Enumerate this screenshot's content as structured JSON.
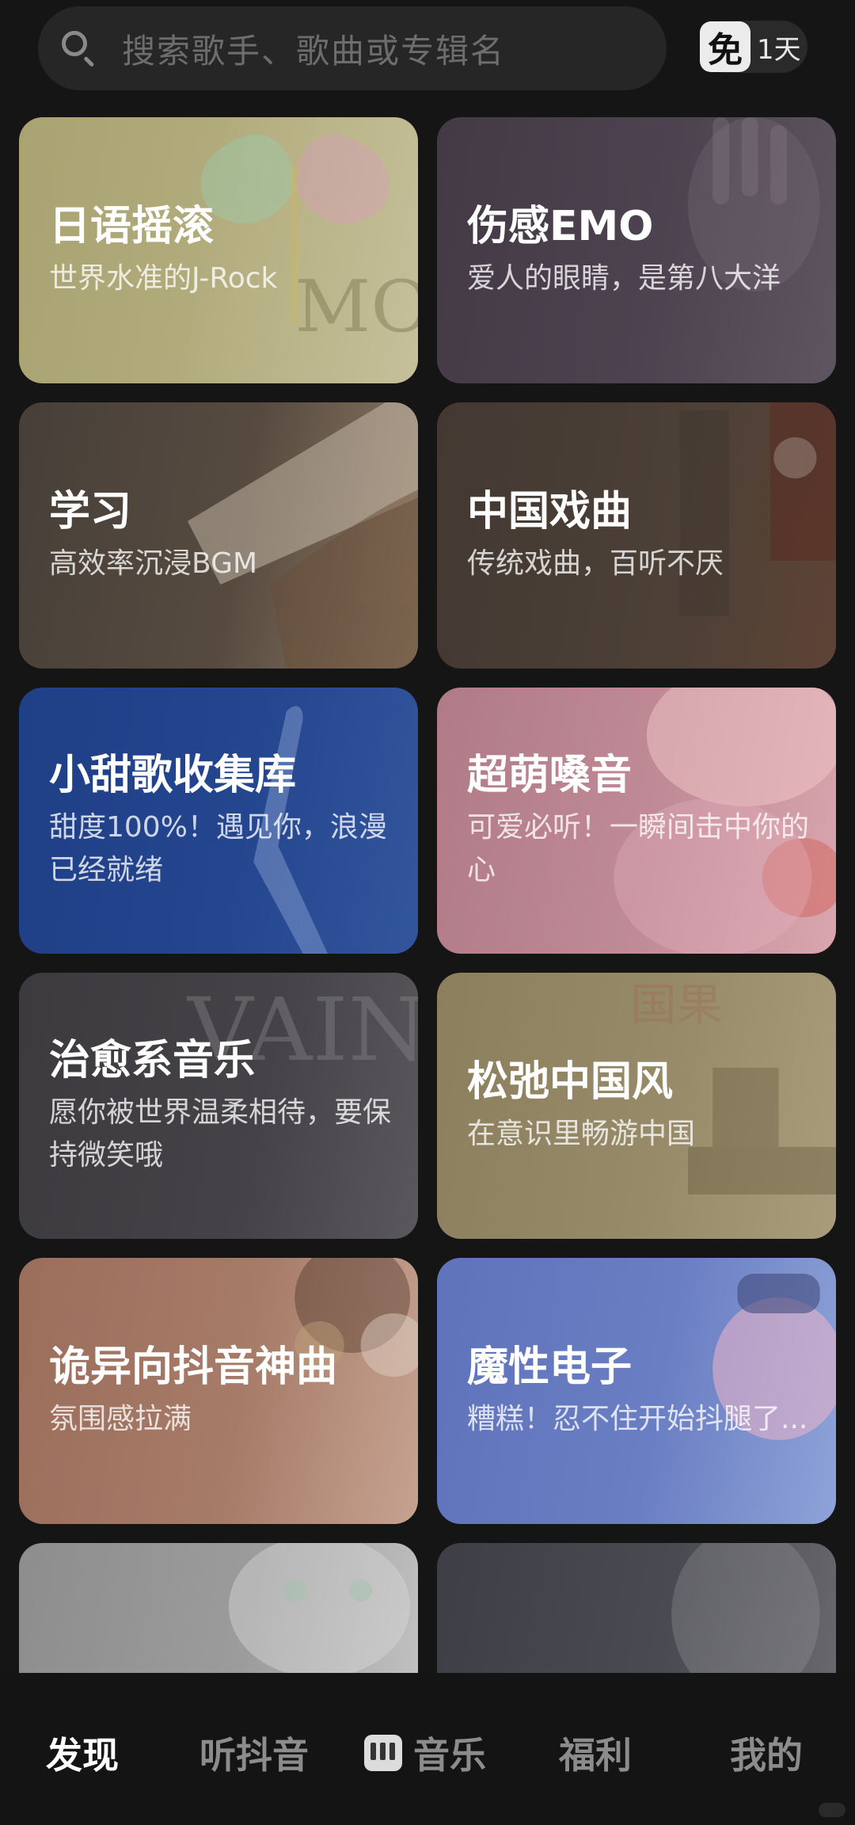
{
  "search": {
    "placeholder": "搜索歌手、歌曲或专辑名",
    "vip_icon": "免",
    "vip_text": "1天"
  },
  "cards": [
    {
      "title": "日语摇滚",
      "subtitle": "世界水准的J-Rock"
    },
    {
      "title": "伤感EMO",
      "subtitle": "爱人的眼睛，是第八大洋"
    },
    {
      "title": "学习",
      "subtitle": "高效率沉浸BGM"
    },
    {
      "title": "中国戏曲",
      "subtitle": "传统戏曲，百听不厌"
    },
    {
      "title": "小甜歌收集库",
      "subtitle": "甜度100%！遇见你，浪漫已经就绪"
    },
    {
      "title": "超萌嗓音",
      "subtitle": "可爱必听！一瞬间击中你的心"
    },
    {
      "title": "治愈系音乐",
      "subtitle": "愿你被世界温柔相待，要保持微笑哦"
    },
    {
      "title": "松弛中国风",
      "subtitle": "在意识里畅游中国"
    },
    {
      "title": "诡异向抖音神曲",
      "subtitle": "氛围感拉满"
    },
    {
      "title": "魔性电子",
      "subtitle": "糟糕！忍不住开始抖腿了..."
    },
    {
      "title": "",
      "subtitle": ""
    },
    {
      "title": "",
      "subtitle": ""
    }
  ],
  "bottom_nav": {
    "discover": "发现",
    "douyin": "听抖音",
    "music": "音乐",
    "welfare": "福利",
    "mine": "我的"
  }
}
